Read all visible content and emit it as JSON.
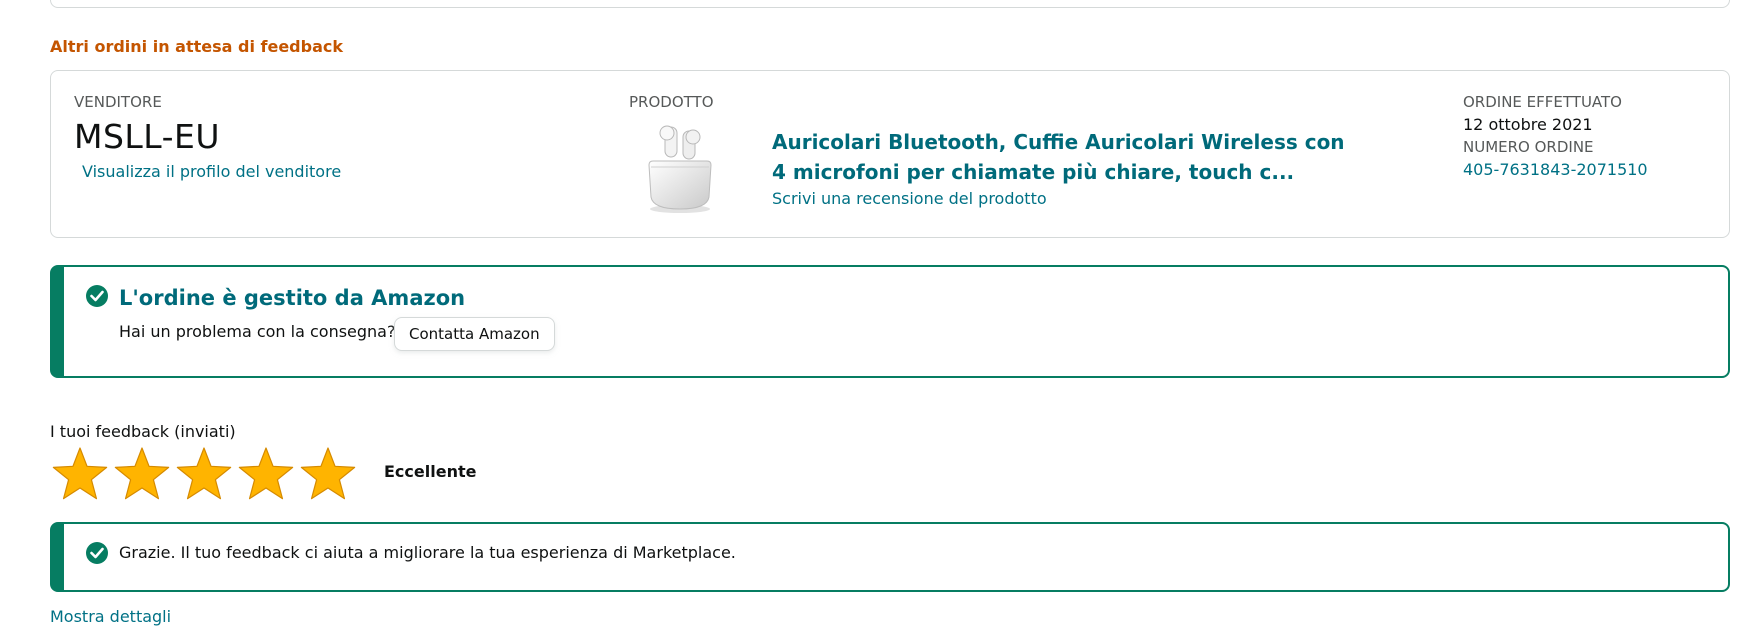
{
  "section": {
    "heading": "Altri ordini in attesa di feedback"
  },
  "order": {
    "seller_label": "VENDITORE",
    "seller_name": "MSLL-EU",
    "seller_profile_link": "Visualizza il profilo del venditore",
    "product_label": "PRODOTTO",
    "product_title": "Auricolari Bluetooth, Cuffie Auricolari Wireless con 4 microfoni per chiamate più chiare, touch c...",
    "review_link": "Scrivi una recensione del prodotto",
    "order_date_label": "ORDINE EFFETTUATO",
    "order_date": "12 ottobre 2021",
    "order_number_label": "NUMERO ORDINE",
    "order_number": "405-7631843-2071510"
  },
  "amazon_alert": {
    "title": "L'ordine è gestito da Amazon",
    "question": "Hai un problema con la consegna?",
    "contact_button": "Contatta Amazon"
  },
  "feedback": {
    "label": "I tuoi feedback (inviati)",
    "rating": 5,
    "rating_max": 5,
    "rating_text": "Eccellente",
    "thanks_text": "Grazie. Il tuo feedback ci aiuta a migliorare la tua esperienza di Marketplace.",
    "details_link": "Mostra dettagli"
  },
  "colors": {
    "accent_orange": "#c45500",
    "link_teal": "#007185",
    "success_green": "#067d62",
    "star_gold": "#ffb400"
  },
  "icons": [
    "check-circle-icon",
    "star-icon",
    "earbuds-product-image"
  ]
}
